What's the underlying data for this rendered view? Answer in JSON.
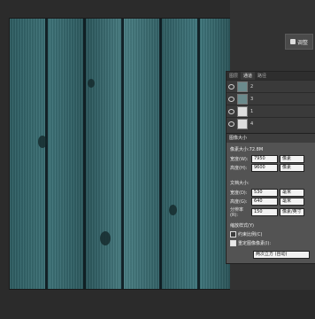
{
  "toolbar": {
    "adjust_label": "调整"
  },
  "layers_panel": {
    "tabs": [
      "图层",
      "通道",
      "路径"
    ],
    "active_tab": 1,
    "layers": [
      {
        "name": "2"
      },
      {
        "name": "3"
      },
      {
        "name": "1"
      },
      {
        "name": "4"
      }
    ]
  },
  "image_size_dialog": {
    "title": "图像大小",
    "pixel_dimensions": "像素大小:72.8M",
    "width_px": {
      "label": "宽度(W):",
      "value": "7950",
      "unit": "像素"
    },
    "height_px": {
      "label": "高度(H):",
      "value": "9600",
      "unit": "像素"
    },
    "doc_size": "文档大小:",
    "width_mm": {
      "label": "宽度(D):",
      "value": "530",
      "unit": "毫米"
    },
    "height_mm": {
      "label": "高度(G):",
      "value": "640",
      "unit": "毫米"
    },
    "resolution": {
      "label": "分辨率(R):",
      "value": "150",
      "unit": "像素/英寸"
    },
    "scale_styles": "缩放样式(Y)",
    "constrain": "约束比例(C)",
    "resample": "重定图像像素(I):",
    "method": "两次立方 (自动)"
  }
}
